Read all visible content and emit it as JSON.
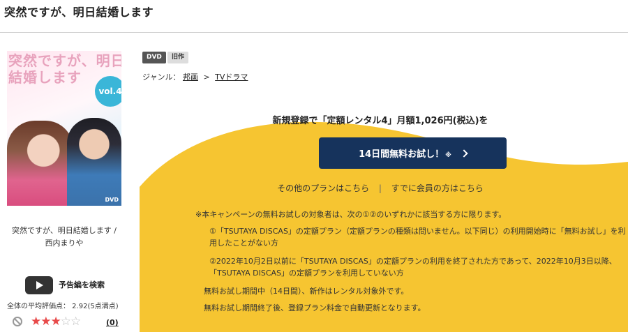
{
  "page": {
    "title": "突然ですが、明日結婚します"
  },
  "cover": {
    "title_art": "突然ですが、明日結婚します",
    "volume_badge": "vol.4",
    "format_mark": "DVD",
    "caption": "突然ですが、明日結婚します / 西内まりや"
  },
  "trailer": {
    "label": "予告編を検索",
    "icon": "play-icon"
  },
  "rating": {
    "average_text": "全体の平均評価点： 2.92(5点満点)",
    "stars_filled": 3,
    "stars_total": 5,
    "review_count": "(0)",
    "star_color": "#e84a4a"
  },
  "tags": [
    "DVD",
    "旧作"
  ],
  "genre": {
    "label": "ジャンル：",
    "items": [
      "邦画",
      "TVドラマ"
    ],
    "separator": ">"
  },
  "campaign": {
    "headline": "新規登録で「定額レンタル4」月額1,026円(税込)を",
    "button_label": "14日間無料お試し！",
    "button_note": "※",
    "button_color": "#16335c",
    "background_color": "#f6c531",
    "other_plans_link": "その他のプランはこちら",
    "divider": "|",
    "member_link": "すでに会員の方はこちら",
    "notes": [
      "※本キャンペーンの無料お試しの対象者は、次の①②のいずれかに該当する方に限ります。",
      "①「TSUTAYA DISCAS」の定額プラン（定額プランの種類は問いません。以下同じ）の利用開始時に「無料お試し」を利用したことがない方",
      "②2022年10月2日以前に「TSUTAYA DISCAS」の定額プランの利用を終了された方であって、2022年10月3日以降、「TSUTAYA DISCAS」の定額プランを利用していない方",
      "無料お試し期間中（14日間）、新作はレンタル対象外です。",
      "無料お試し期間終了後、登録プラン料金で自動更新となります。"
    ]
  }
}
